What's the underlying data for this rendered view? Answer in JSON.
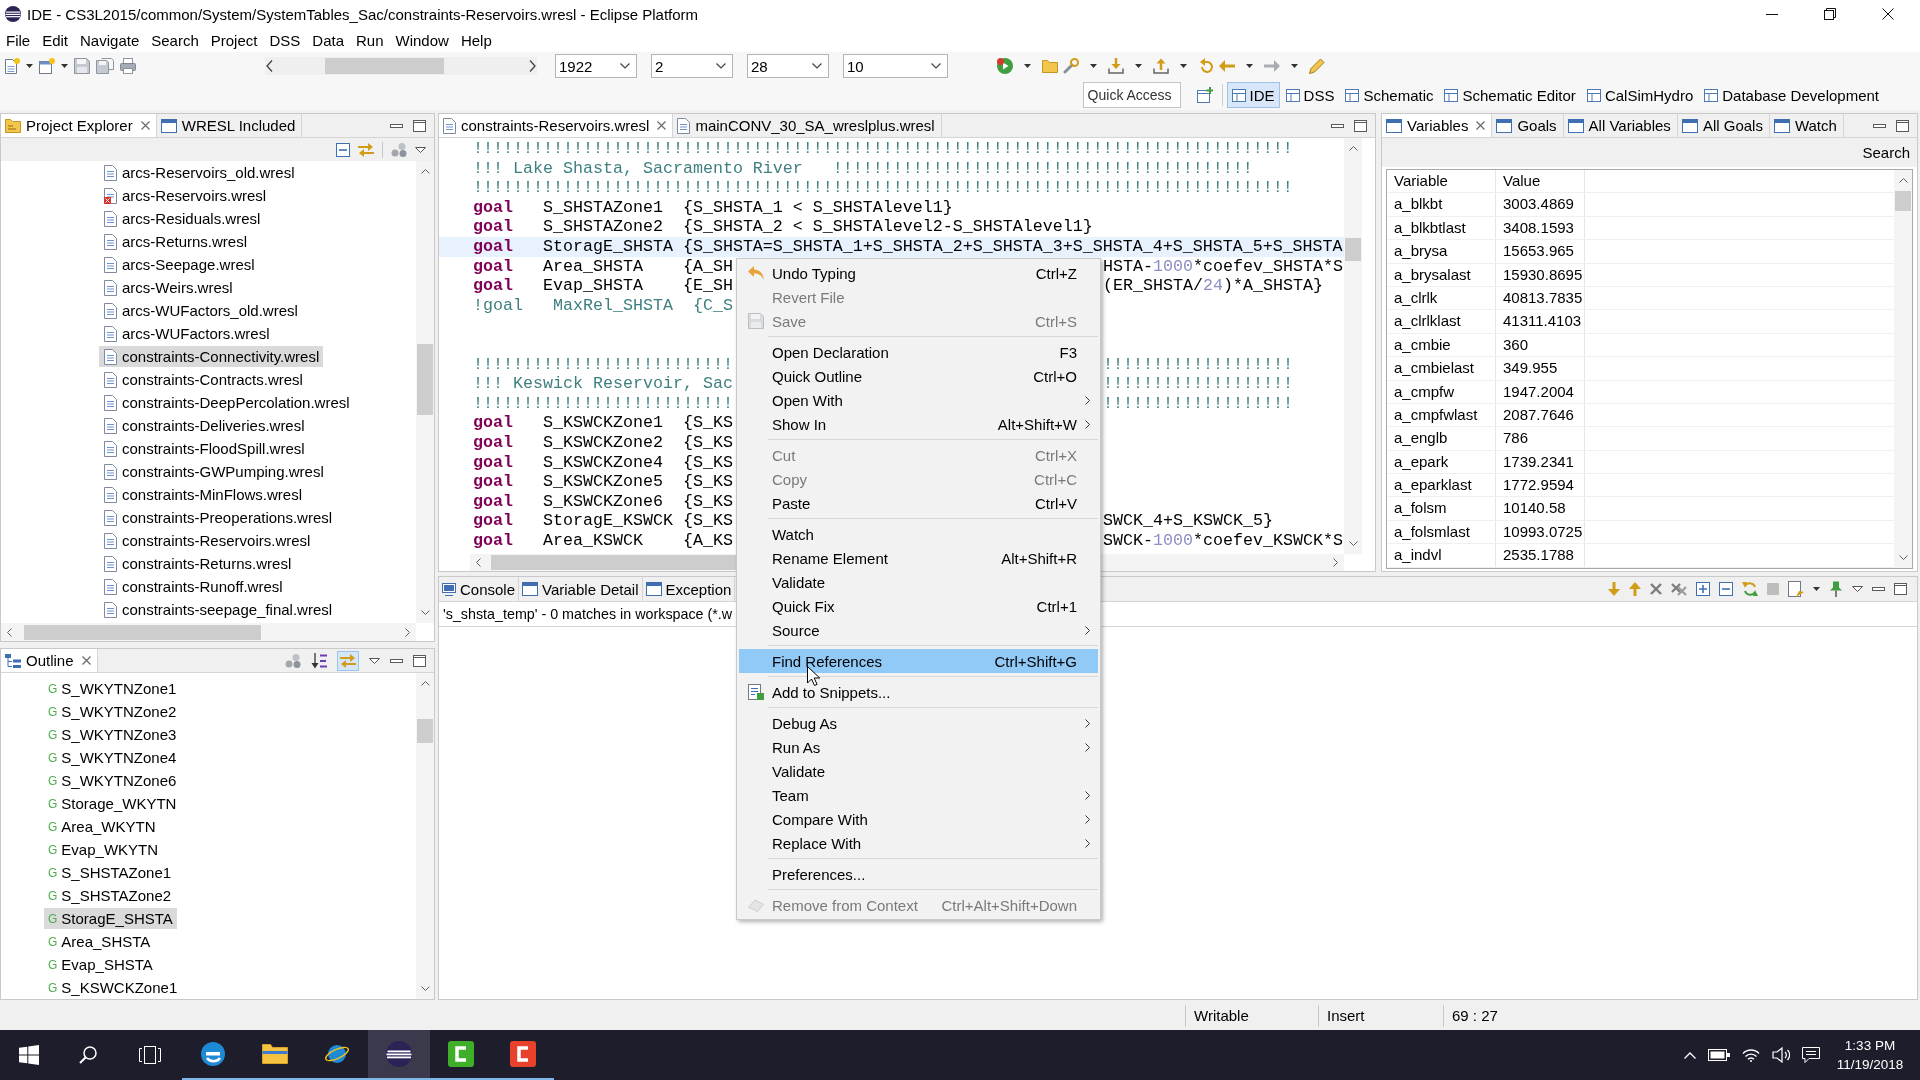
{
  "window": {
    "title": "IDE - CS3L2015/common/System/SystemTables_Sac/constraints-Reservoirs.wresl - Eclipse Platform"
  },
  "menu_bar": [
    "File",
    "Edit",
    "Navigate",
    "Search",
    "Project",
    "DSS",
    "Data",
    "Run",
    "Window",
    "Help"
  ],
  "toolbar": {
    "combos": [
      {
        "value": "1922"
      },
      {
        "value": "2"
      },
      {
        "value": "28"
      },
      {
        "value": "10"
      }
    ],
    "quick_access": {
      "placeholder": "Quick Access"
    },
    "perspectives": [
      {
        "label": "IDE",
        "selected": true
      },
      {
        "label": "DSS",
        "selected": false
      },
      {
        "label": "Schematic",
        "selected": false
      },
      {
        "label": "Schematic Editor",
        "selected": false
      },
      {
        "label": "CalSimHydro",
        "selected": false
      },
      {
        "label": "Database Development",
        "selected": false
      }
    ]
  },
  "project_explorer": {
    "tabs": [
      {
        "label": "Project Explorer",
        "selected": true
      },
      {
        "label": "WRESL Included",
        "selected": false
      }
    ],
    "items": [
      {
        "label": "arcs-Reservoirs_old.wresl",
        "selected": false,
        "error": false
      },
      {
        "label": "arcs-Reservoirs.wresl",
        "selected": false,
        "error": true
      },
      {
        "label": "arcs-Residuals.wresl",
        "selected": false,
        "error": false
      },
      {
        "label": "arcs-Returns.wresl",
        "selected": false,
        "error": false
      },
      {
        "label": "arcs-Seepage.wresl",
        "selected": false,
        "error": false
      },
      {
        "label": "arcs-Weirs.wresl",
        "selected": false,
        "error": false
      },
      {
        "label": "arcs-WUFactors_old.wresl",
        "selected": false,
        "error": false
      },
      {
        "label": "arcs-WUFactors.wresl",
        "selected": false,
        "error": false
      },
      {
        "label": "constraints-Connectivity.wresl",
        "selected": true,
        "error": false
      },
      {
        "label": "constraints-Contracts.wresl",
        "selected": false,
        "error": false
      },
      {
        "label": "constraints-DeepPercolation.wresl",
        "selected": false,
        "error": false
      },
      {
        "label": "constraints-Deliveries.wresl",
        "selected": false,
        "error": false
      },
      {
        "label": "constraints-FloodSpill.wresl",
        "selected": false,
        "error": false
      },
      {
        "label": "constraints-GWPumping.wresl",
        "selected": false,
        "error": false
      },
      {
        "label": "constraints-MinFlows.wresl",
        "selected": false,
        "error": false
      },
      {
        "label": "constraints-Preoperations.wresl",
        "selected": false,
        "error": false
      },
      {
        "label": "constraints-Reservoirs.wresl",
        "selected": false,
        "error": false
      },
      {
        "label": "constraints-Returns.wresl",
        "selected": false,
        "error": false
      },
      {
        "label": "constraints-Runoff.wresl",
        "selected": false,
        "error": false
      },
      {
        "label": "constraints-seepage_final.wresl",
        "selected": false,
        "error": false
      }
    ]
  },
  "outline": {
    "tabs": [
      {
        "label": "Outline",
        "selected": true
      }
    ],
    "toggle_button": {
      "on": true
    },
    "items": [
      {
        "marker": "G",
        "label": "S_WKYTNZone1",
        "selected": false
      },
      {
        "marker": "G",
        "label": "S_WKYTNZone2",
        "selected": false
      },
      {
        "marker": "G",
        "label": "S_WKYTNZone3",
        "selected": false
      },
      {
        "marker": "G",
        "label": "S_WKYTNZone4",
        "selected": false
      },
      {
        "marker": "G",
        "label": "S_WKYTNZone6",
        "selected": false
      },
      {
        "marker": "G",
        "label": "Storage_WKYTN",
        "selected": false
      },
      {
        "marker": "G",
        "label": "Area_WKYTN",
        "selected": false
      },
      {
        "marker": "G",
        "label": "Evap_WKYTN",
        "selected": false
      },
      {
        "marker": "G",
        "label": "S_SHSTAZone1",
        "selected": false
      },
      {
        "marker": "G",
        "label": "S_SHSTAZone2",
        "selected": false
      },
      {
        "marker": "G",
        "label": "StoragE_SHSTA",
        "selected": true
      },
      {
        "marker": "G",
        "label": "Area_SHSTA",
        "selected": false
      },
      {
        "marker": "G",
        "label": "Evap_SHSTA",
        "selected": false
      },
      {
        "marker": "G",
        "label": "S_KSWCKZone1",
        "selected": false
      }
    ]
  },
  "editor": {
    "tabs": [
      {
        "label": "constraints-Reservoirs.wresl",
        "selected": true
      },
      {
        "label": "mainCONV_30_SA_wreslplus.wresl",
        "selected": false
      }
    ],
    "lines": [
      {
        "kind": "comment",
        "current": false,
        "left": "!!!!!!!!!!!!!!!!!!!!!!!!!!!!!!!!!!!!!!!!!!!!!!!!!!!!!!!!!!!!!!!!!!!!!!!!!!!!!!!!!!"
      },
      {
        "kind": "comment",
        "current": false,
        "left": "!!! Lake Shasta, Sacramento River   !!!!!!!!!!!!!!!!!!!!!!!!!!!!!!!!!!!!!!!!!!"
      },
      {
        "kind": "comment",
        "current": false,
        "left": "!!!!!!!!!!!!!!!!!!!!!!!!!!!!!!!!!!!!!!!!!!!!!!!!!!!!!!!!!!!!!!!!!!!!!!!!!!!!!!!!!!"
      },
      {
        "kind": "code",
        "current": false,
        "left": "**goal**   S_SHSTAZone1  {S_SHSTA_1 < S_SHSTAlevel1}"
      },
      {
        "kind": "code",
        "current": false,
        "left": "**goal**   S_SHSTAZone2  {S_SHSTA_2 < S_SHSTAlevel2-S_SHSTAlevel1}"
      },
      {
        "kind": "code",
        "current": true,
        "left": "**goal**   StoragE_SHSTA {S_SHSTA=S_SHSTA_1+S_SHSTA_2+S_SHSTA_3+S_SHSTA_4+S_SHSTA_5+S_SHSTA"
      },
      {
        "kind": "code",
        "current": false,
        "left": "**goal**   Area_SHSTA    {A_SH",
        "right": "HSTA-1000*coefev_SHSTA*S"
      },
      {
        "kind": "code",
        "current": false,
        "left": "**goal**   Evap_SHSTA    {E_SH",
        "right": "(ER_SHSTA/24)*A_SHSTA}"
      },
      {
        "kind": "comment",
        "current": false,
        "left": "!goal   MaxRel_SHSTA  {C_S"
      },
      {
        "kind": "blank",
        "current": false
      },
      {
        "kind": "blank",
        "current": false
      },
      {
        "kind": "comment",
        "current": false,
        "left": "!!!!!!!!!!!!!!!!!!!!!!!!!!",
        "right": "!!!!!!!!!!!!!!!!!!!"
      },
      {
        "kind": "comment",
        "current": false,
        "left": "!!! Keswick Reservoir, Sac",
        "right": "!!!!!!!!!!!!!!!!!!!"
      },
      {
        "kind": "comment",
        "current": false,
        "left": "!!!!!!!!!!!!!!!!!!!!!!!!!!",
        "right": "!!!!!!!!!!!!!!!!!!!"
      },
      {
        "kind": "code",
        "current": false,
        "left": "**goal**   S_KSWCKZone1  {S_KS"
      },
      {
        "kind": "code",
        "current": false,
        "left": "**goal**   S_KSWCKZone2  {S_KS"
      },
      {
        "kind": "code",
        "current": false,
        "left": "**goal**   S_KSWCKZone4  {S_KS"
      },
      {
        "kind": "code",
        "current": false,
        "left": "**goal**   S_KSWCKZone5  {S_KS"
      },
      {
        "kind": "code",
        "current": false,
        "left": "**goal**   S_KSWCKZone6  {S_KS"
      },
      {
        "kind": "code",
        "current": false,
        "left": "**goal**   StoragE_KSWCK {S_KS",
        "right": "SWCK_4+S_KSWCK_5}"
      },
      {
        "kind": "code",
        "current": false,
        "left": "**goal**   Area_KSWCK    {A_KS",
        "right": "SWCK-1000*coefev_KSWCK*S"
      }
    ]
  },
  "variables_view": {
    "tabs": [
      {
        "label": "Variables",
        "selected": true
      },
      {
        "label": "Goals",
        "selected": false
      },
      {
        "label": "All Variables",
        "selected": false
      },
      {
        "label": "All Goals",
        "selected": false
      },
      {
        "label": "Watch",
        "selected": false
      }
    ],
    "search_button": "Search",
    "table": {
      "columns": [
        "Variable",
        "Value"
      ],
      "rows": [
        [
          "a_blkbt",
          "3003.4869"
        ],
        [
          "a_blkbtlast",
          "3408.1593"
        ],
        [
          "a_brysa",
          "15653.965"
        ],
        [
          "a_brysalast",
          "15930.8695"
        ],
        [
          "a_clrlk",
          "40813.7835"
        ],
        [
          "a_clrlklast",
          "41311.4103"
        ],
        [
          "a_cmbie",
          "360"
        ],
        [
          "a_cmbielast",
          "349.955"
        ],
        [
          "a_cmpfw",
          "1947.2004"
        ],
        [
          "a_cmpfwlast",
          "2087.7646"
        ],
        [
          "a_englb",
          "786"
        ],
        [
          "a_epark",
          "1739.2341"
        ],
        [
          "a_eparklast",
          "1772.9594"
        ],
        [
          "a_folsm",
          "10140.58"
        ],
        [
          "a_folsmlast",
          "10993.0725"
        ],
        [
          "a_indvl",
          "2535.1788"
        ]
      ]
    }
  },
  "bottom_panel": {
    "tabs": [
      {
        "label": "Console",
        "selected": false
      },
      {
        "label": "Variable Detail",
        "selected": false
      },
      {
        "label": "Exception",
        "selected": false
      }
    ],
    "search_result": "'s_shsta_temp' - 0 matches in workspace (*.w"
  },
  "context_menu": {
    "groups": [
      {
        "items": [
          {
            "label": "Undo Typing",
            "shortcut": "Ctrl+Z",
            "disabled": false,
            "submenu": false,
            "selected": false
          },
          {
            "label": "Revert File",
            "disabled": true,
            "submenu": false,
            "selected": false
          },
          {
            "label": "Save",
            "shortcut": "Ctrl+S",
            "disabled": true,
            "submenu": false,
            "selected": false
          }
        ]
      },
      {
        "items": [
          {
            "label": "Open Declaration",
            "shortcut": "F3",
            "disabled": false,
            "submenu": false,
            "selected": false
          },
          {
            "label": "Quick Outline",
            "shortcut": "Ctrl+O",
            "disabled": false,
            "submenu": false,
            "selected": false
          },
          {
            "label": "Open With",
            "disabled": false,
            "submenu": true,
            "selected": false
          },
          {
            "label": "Show In",
            "shortcut": "Alt+Shift+W",
            "disabled": false,
            "submenu": true,
            "selected": false
          }
        ]
      },
      {
        "items": [
          {
            "label": "Cut",
            "shortcut": "Ctrl+X",
            "disabled": true,
            "submenu": false,
            "selected": false
          },
          {
            "label": "Copy",
            "shortcut": "Ctrl+C",
            "disabled": true,
            "submenu": false,
            "selected": false
          },
          {
            "label": "Paste",
            "shortcut": "Ctrl+V",
            "disabled": false,
            "submenu": false,
            "selected": false
          }
        ]
      },
      {
        "items": [
          {
            "label": "Watch",
            "disabled": false,
            "submenu": false,
            "selected": false
          },
          {
            "label": "Rename Element",
            "shortcut": "Alt+Shift+R",
            "disabled": false,
            "submenu": false,
            "selected": false
          },
          {
            "label": "Validate",
            "disabled": false,
            "submenu": false,
            "selected": false
          },
          {
            "label": "Quick Fix",
            "shortcut": "Ctrl+1",
            "disabled": false,
            "submenu": false,
            "selected": false
          },
          {
            "label": "Source",
            "disabled": false,
            "submenu": true,
            "selected": false
          }
        ]
      },
      {
        "items": [
          {
            "label": "Find References",
            "shortcut": "Ctrl+Shift+G",
            "disabled": false,
            "submenu": false,
            "selected": true
          }
        ]
      },
      {
        "items": [
          {
            "label": "Add to Snippets...",
            "disabled": false,
            "submenu": false,
            "selected": false
          }
        ]
      },
      {
        "items": [
          {
            "label": "Debug As",
            "disabled": false,
            "submenu": true,
            "selected": false
          },
          {
            "label": "Run As",
            "disabled": false,
            "submenu": true,
            "selected": false
          },
          {
            "label": "Validate",
            "disabled": false,
            "submenu": false,
            "selected": false
          },
          {
            "label": "Team",
            "disabled": false,
            "submenu": true,
            "selected": false
          },
          {
            "label": "Compare With",
            "disabled": false,
            "submenu": true,
            "selected": false
          },
          {
            "label": "Replace With",
            "disabled": false,
            "submenu": true,
            "selected": false
          }
        ]
      },
      {
        "items": [
          {
            "label": "Preferences...",
            "disabled": false,
            "submenu": false,
            "selected": false
          }
        ]
      },
      {
        "items": [
          {
            "label": "Remove from Context",
            "shortcut": "Ctrl+Alt+Shift+Down",
            "disabled": true,
            "submenu": false,
            "selected": false
          }
        ]
      }
    ]
  },
  "status_bar": {
    "fields": [
      "Writable",
      "Insert",
      "69 : 27"
    ]
  },
  "taskbar": {
    "apps": [
      {
        "running": true,
        "selected": false
      },
      {
        "running": true,
        "selected": false
      },
      {
        "running": true,
        "selected": false
      },
      {
        "running": true,
        "selected": true
      },
      {
        "running": true,
        "selected": false
      },
      {
        "running": true,
        "selected": false
      }
    ],
    "time": "1:33 PM",
    "date": "11/19/2018"
  }
}
